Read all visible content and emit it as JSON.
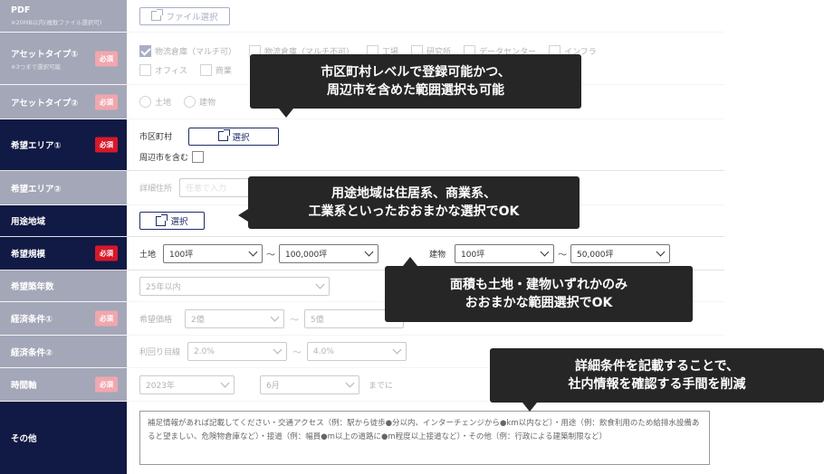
{
  "rows": {
    "pdf": {
      "label": "PDF",
      "sub": "※20MB以内(複数ファイル選択可)",
      "button": "ファイル選択"
    },
    "asset1": {
      "label": "アセットタイプ①",
      "sub": "※3つまで選択可能",
      "required": "必須",
      "options": [
        "物流倉庫（マルチ可）",
        "物流倉庫（マルチ不可）",
        "工場",
        "研究所",
        "データセンター",
        "インフラ",
        "オフィス",
        "商業"
      ]
    },
    "asset2": {
      "label": "アセットタイプ②",
      "required": "必須",
      "options": [
        "土地",
        "建物"
      ]
    },
    "area1": {
      "label": "希望エリア①",
      "required": "必須",
      "city_label": "市区町村",
      "select_button": "選択",
      "include_label": "周辺市を含む"
    },
    "area2": {
      "label": "希望エリア②",
      "detail_label": "詳細住所",
      "placeholder": "任意で入力"
    },
    "usage": {
      "label": "用途地域",
      "select_button": "選択"
    },
    "scale": {
      "label": "希望規模",
      "required": "必須",
      "land_label": "土地",
      "land_min": "100坪",
      "land_max": "100,000坪",
      "building_label": "建物",
      "bld_min": "100坪",
      "bld_max": "50,000坪",
      "tilde": "〜"
    },
    "age": {
      "label": "希望築年数",
      "value": "25年以内"
    },
    "econ1": {
      "label": "経済条件①",
      "required": "必須",
      "price_label": "希望価格",
      "min": "2億",
      "max": "5億",
      "tilde": "〜"
    },
    "econ2": {
      "label": "経済条件②",
      "yield_label": "利回り目線",
      "min": "2.0%",
      "max": "4.0%",
      "tilde": "〜"
    },
    "timeline": {
      "label": "時間軸",
      "required": "必須",
      "year": "2023年",
      "month": "6月",
      "suffix": "までに"
    },
    "other": {
      "label": "その他",
      "placeholder": "補足情報があれば記載してください・交通アクセス（例：駅から徒歩●分以内、インターチェンジから●km以内など）・用途（例：飲食利用のため給排水設備あると望ましい、危険物倉庫など）・接道（例：幅員●m以上の道路に●m程度以上接道など）・その他（例：行政による建築制限など）"
    }
  },
  "callouts": {
    "c1": [
      "市区町村レベルで登録可能かつ、",
      "周辺市を含めた範囲選択も可能"
    ],
    "c2": [
      "用途地域は住居系、商業系、",
      "工業系といったおおまかな選択でOK"
    ],
    "c3": [
      "面積も土地・建物いずれかのみ",
      "おおまかな範囲選択でOK"
    ],
    "c4": [
      "詳細条件を記載することで、",
      "社内情報を確認する手間を削減"
    ]
  }
}
